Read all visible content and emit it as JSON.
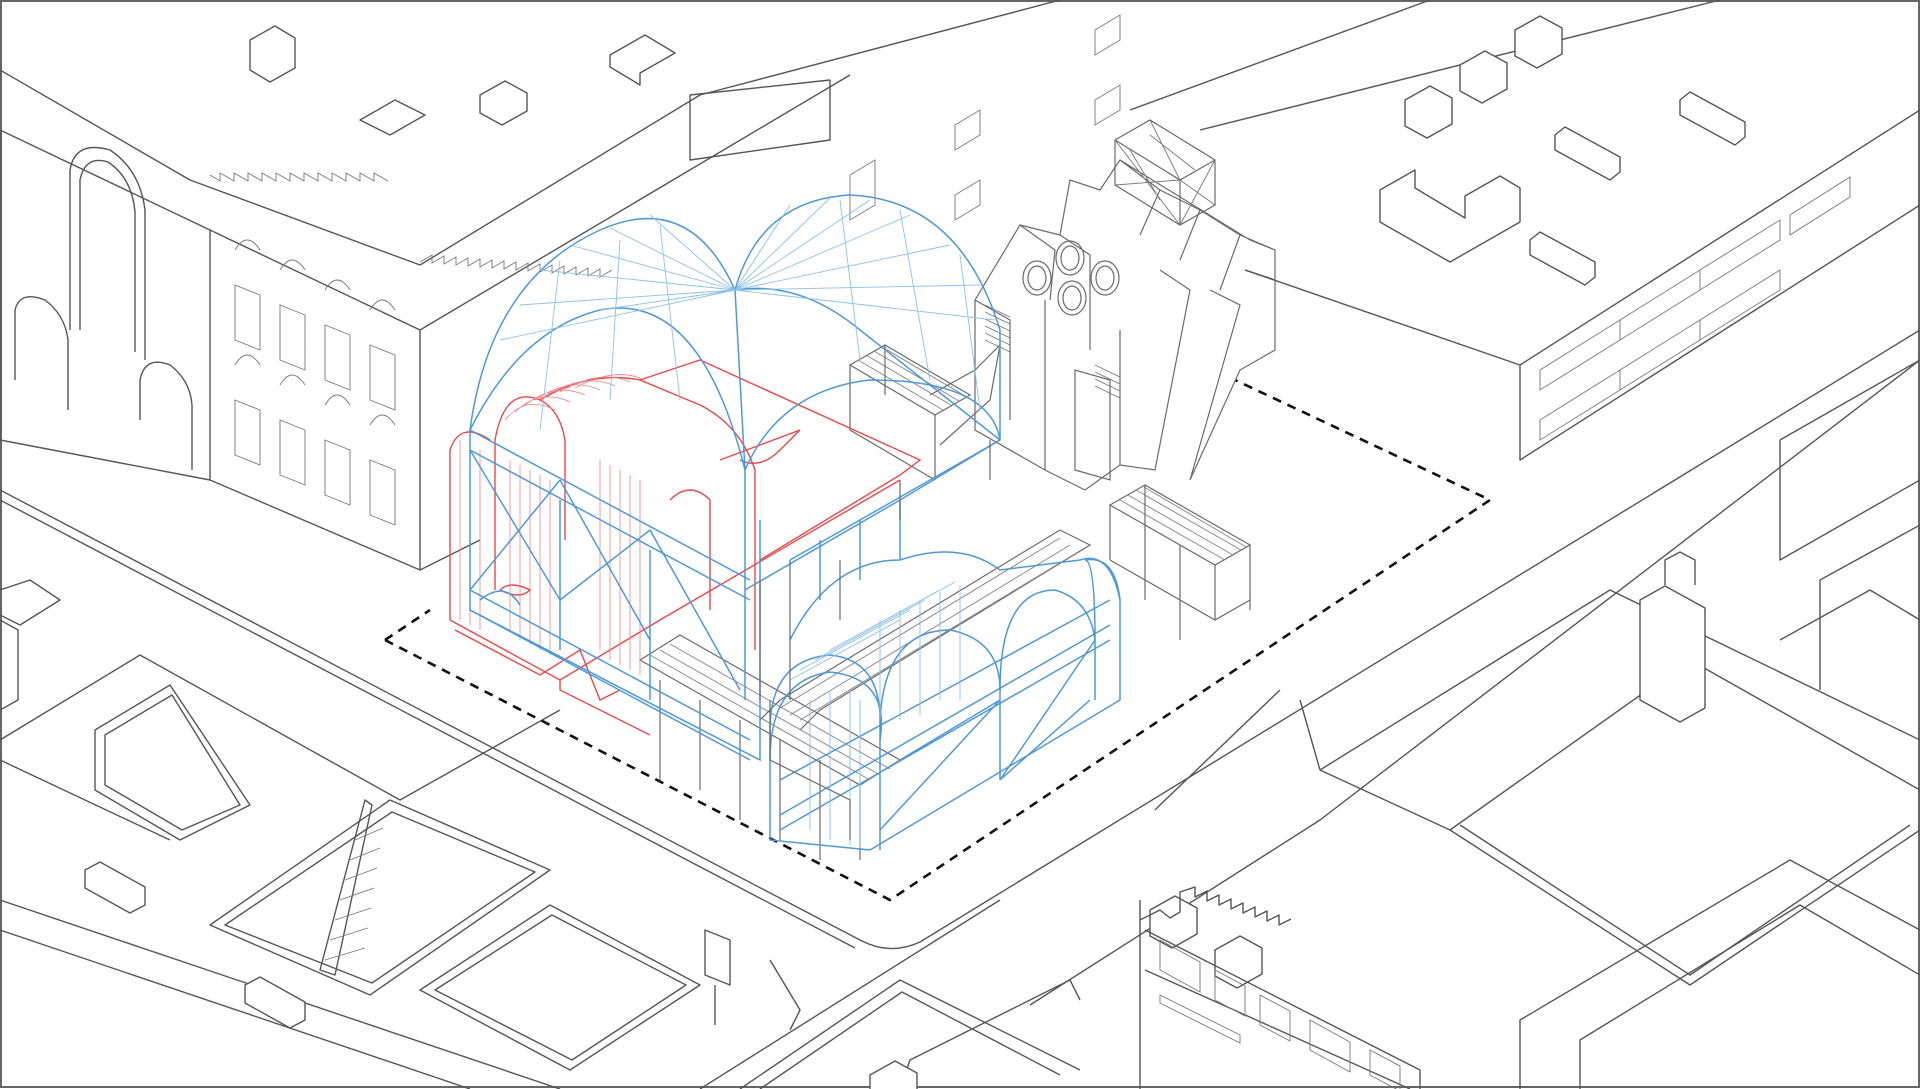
{
  "diagram": {
    "type": "axonometric architectural drawing",
    "palette": {
      "background": "#ffffff",
      "context": "#555555",
      "structure_blue": "#4f98d8",
      "structure_red": "#e8474a",
      "site_boundary": "#111111"
    }
  }
}
